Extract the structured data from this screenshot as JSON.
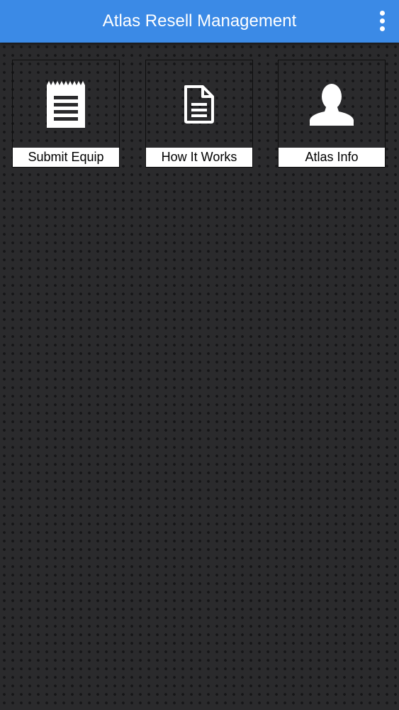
{
  "app_bar": {
    "title": "Atlas Resell Management",
    "background_color": "#3b8ae6",
    "menu_icon": "more-vertical-icon"
  },
  "tiles": [
    {
      "label": "Submit Equip",
      "icon": "receipt-list-icon"
    },
    {
      "label": "How It Works",
      "icon": "document-icon"
    },
    {
      "label": "Atlas Info",
      "icon": "person-icon"
    }
  ],
  "colors": {
    "background": "#2a2a2c",
    "tile_label_background": "#ffffff",
    "icon": "#ffffff"
  }
}
